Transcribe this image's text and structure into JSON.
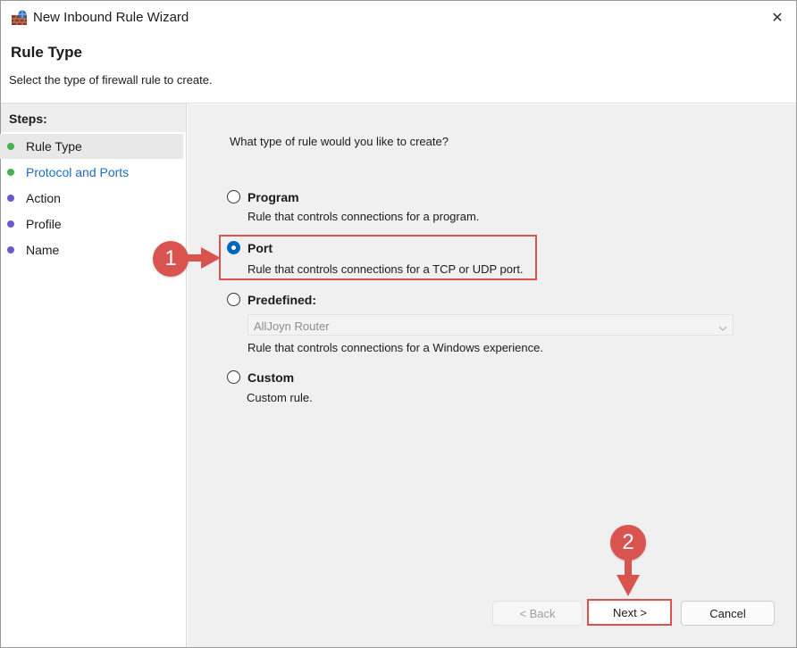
{
  "window": {
    "title": "New Inbound Rule Wizard",
    "close_glyph": "✕"
  },
  "header": {
    "title": "Rule Type",
    "subtitle": "Select the type of firewall rule to create."
  },
  "steps": {
    "label": "Steps:",
    "items": [
      {
        "label": "Rule Type",
        "dot_color": "#4caf50",
        "text_color": "#1b1b1b",
        "active": true
      },
      {
        "label": "Protocol and Ports",
        "dot_color": "#4caf50",
        "text_color": "#1a6fc4",
        "active": false
      },
      {
        "label": "Action",
        "dot_color": "#6a5acd",
        "text_color": "#1b1b1b",
        "active": false
      },
      {
        "label": "Profile",
        "dot_color": "#6a5acd",
        "text_color": "#1b1b1b",
        "active": false
      },
      {
        "label": "Name",
        "dot_color": "#6a5acd",
        "text_color": "#1b1b1b",
        "active": false
      }
    ]
  },
  "main": {
    "question": "What type of rule would you like to create?",
    "options": {
      "program": {
        "title": "Program",
        "desc": "Rule that controls connections for a program.",
        "checked": false
      },
      "port": {
        "title": "Port",
        "desc": "Rule that controls connections for a TCP or UDP port.",
        "checked": true
      },
      "predefined": {
        "title": "Predefined:",
        "select_value": "AllJoyn Router",
        "desc": "Rule that controls connections for a Windows experience.",
        "checked": false
      },
      "custom": {
        "title": "Custom",
        "desc": "Custom rule.",
        "checked": false
      }
    }
  },
  "annotations": {
    "badge1": "1",
    "badge2": "2",
    "color": "#d9534f"
  },
  "buttons": {
    "back": "< Back",
    "next": "Next >",
    "cancel": "Cancel"
  }
}
